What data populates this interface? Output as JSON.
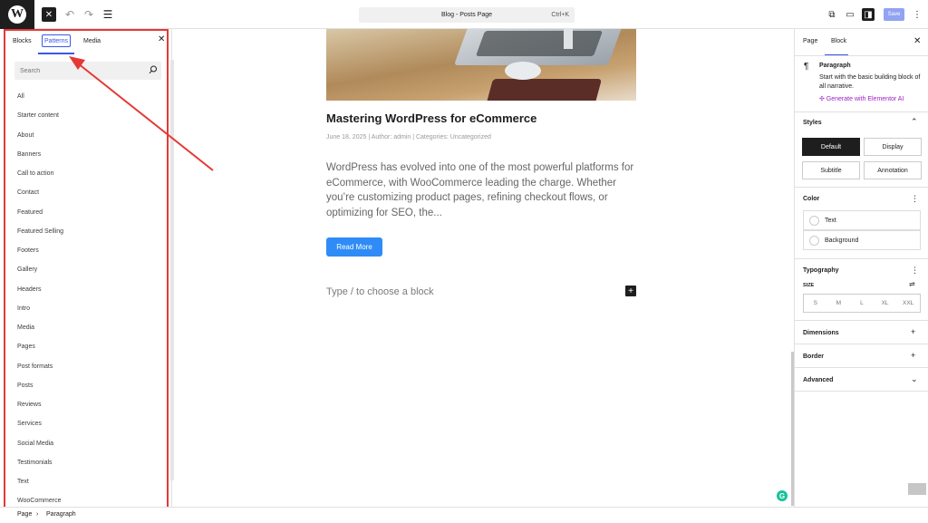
{
  "topbar": {
    "logo": "W",
    "close_icon": "✕",
    "undo_icon": "↶",
    "redo_icon": "↷",
    "list_icon": "☰",
    "doc_title": "Blog - Posts Page",
    "shortcut": "Ctrl+K",
    "view_icon": "⧉",
    "device_icon": "▭",
    "settings_icon": "◨",
    "save_label": "Save",
    "more_icon": "⋮"
  },
  "inserter": {
    "tabs": {
      "blocks": "Blocks",
      "patterns": "Patterns",
      "media": "Media"
    },
    "close": "✕",
    "search_placeholder": "Search",
    "categories": [
      "All",
      "Starter content",
      "About",
      "Banners",
      "Call to action",
      "Contact",
      "Featured",
      "Featured Selling",
      "Footers",
      "Gallery",
      "Headers",
      "Intro",
      "Media",
      "Pages",
      "Post formats",
      "Posts",
      "Reviews",
      "Services",
      "Social Media",
      "Testimonials",
      "Text",
      "WooCommerce"
    ]
  },
  "footer": {
    "page": "Page",
    "separator": "›",
    "current": "Paragraph"
  },
  "post": {
    "title": "Mastering WordPress for eCommerce",
    "meta": "June 18, 2025 | Author: admin | Categories: Uncategorized",
    "excerpt": "WordPress has evolved into one of the most powerful platforms for eCommerce, with WooCommerce leading the charge. Whether you’re customizing product pages, refining checkout flows, or optimizing for SEO, the...",
    "read_more": "Read More",
    "placeholder": "Type / to choose a block",
    "add_icon": "+",
    "grammarly": "G"
  },
  "settings": {
    "tabs": {
      "page": "Page",
      "block": "Block"
    },
    "close": "✕",
    "block_icon": "¶",
    "block_name": "Paragraph",
    "block_desc": "Start with the basic building block of all narrative.",
    "ai_link": "✣ Generate with Elementor AI",
    "styles": {
      "title": "Styles",
      "toggle": "⌃",
      "options": [
        "Default",
        "Display",
        "Subtitle",
        "Annotation"
      ]
    },
    "color": {
      "title": "Color",
      "more": "⋮",
      "text": "Text",
      "background": "Background"
    },
    "typography": {
      "title": "Typography",
      "more": "⋮",
      "size_label": "SIZE",
      "size_ctrl": "⇌",
      "sizes": [
        "S",
        "M",
        "L",
        "XL",
        "XXL"
      ]
    },
    "dimensions": {
      "title": "Dimensions",
      "add": "+"
    },
    "border": {
      "title": "Border",
      "add": "+"
    },
    "advanced": {
      "title": "Advanced",
      "toggle": "⌄"
    }
  },
  "colors": {
    "accent": "#3858e9",
    "annotation": "#e53935",
    "button": "#2f8cf6",
    "ai": "#a020c8"
  }
}
